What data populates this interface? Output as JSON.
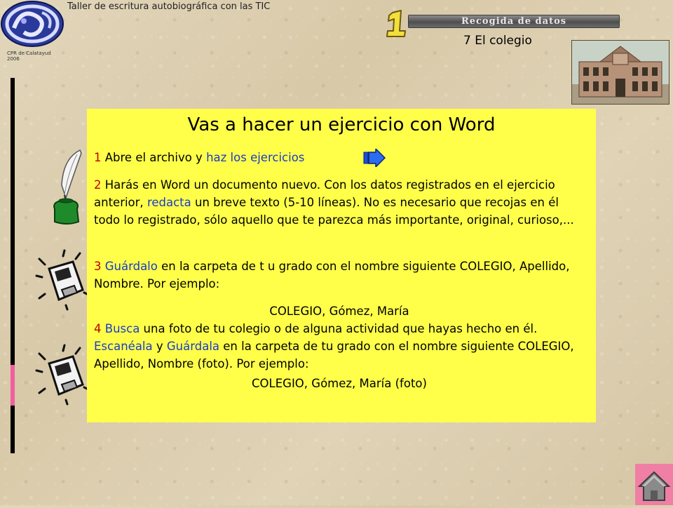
{
  "header": {
    "title": "Taller de escritura autobiográfica con las TIC",
    "logo_caption_line1": "CPR de Calatayud",
    "logo_caption_line2": "2006",
    "step_number": "1",
    "section_banner": "Recogida de datos",
    "topic": "7 El colegio"
  },
  "content": {
    "title": "Vas a hacer un ejercicio con Word",
    "step1": {
      "number": "1",
      "text": " Abre el archivo y ",
      "link": "haz los ejercicios"
    },
    "step2": {
      "number": "2",
      "text_a": " Harás en Word un documento nuevo.  Con los datos registrados en el ejercicio anterior, ",
      "keyword": "redacta",
      "text_b": " un breve texto (5-10 líneas). No es necesario que recojas en él todo lo registrado, sólo aquello que te parezca más importante, original, curioso,..."
    },
    "step3": {
      "number": "3",
      "keyword": "Guárdalo",
      "text": "  en la carpeta de t u grado con el nombre siguiente COLEGIO, Apellido, Nombre. Por ejemplo:",
      "example": "COLEGIO, Gómez, María"
    },
    "step4": {
      "number": "4",
      "keyword1": "Busca",
      "text_a": " una foto de tu colegio o de alguna actividad que hayas hecho en él. ",
      "keyword2": "Escanéala",
      "text_b": " y ",
      "keyword3": "Guárdala",
      "text_c": "  en la carpeta de tu grado con el nombre siguiente COLEGIO, Apellido, Nombre (foto). Por ejemplo:",
      "example": "COLEGIO, Gómez, María (foto)"
    }
  },
  "colors": {
    "content_background": "#ffff4a",
    "step_number": "#c00000",
    "keyword": "#1a3cc8",
    "home_button": "#ef7fa5"
  },
  "icons": {
    "logo": "logo-icon",
    "quill": "quill-inkwell-icon",
    "floppy": "floppy-disk-icon",
    "next": "next-arrow-icon",
    "home": "home-icon"
  }
}
